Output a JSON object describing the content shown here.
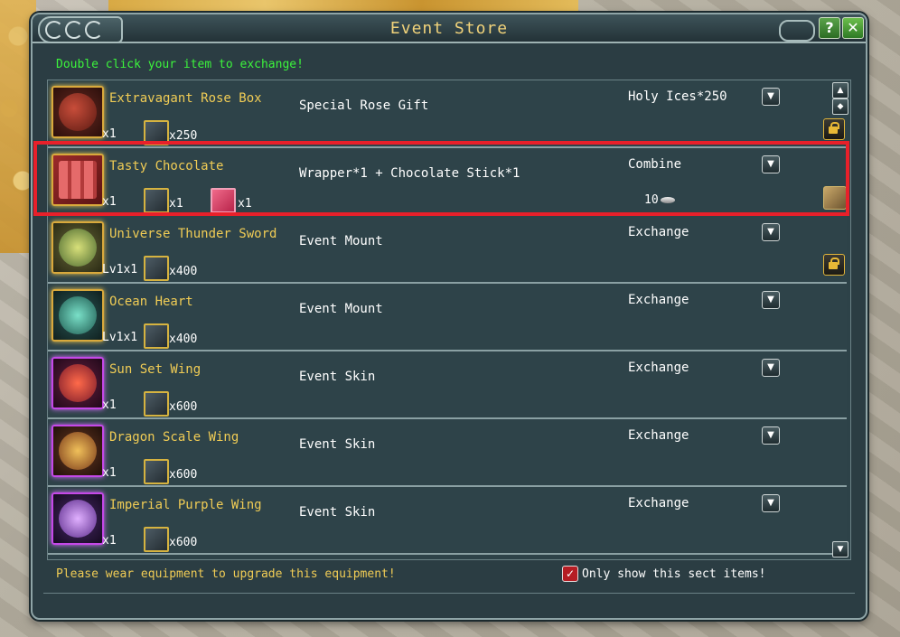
{
  "window": {
    "title": "Event Store",
    "help_label": "?",
    "close_label": "✕"
  },
  "instruction": "Double click your item to exchange!",
  "items": [
    {
      "name": "Extravagant Rose Box",
      "qty": "x1",
      "materials": [
        {
          "count": "x250"
        }
      ],
      "description": "Special Rose Gift",
      "action": "Holy Ices*250",
      "locked": true,
      "icon": "rose-box-icon"
    },
    {
      "name": "Tasty Chocolate",
      "qty": "x1",
      "materials": [
        {
          "count": "x1"
        },
        {
          "count": "x1"
        }
      ],
      "description": "Wrapper*1 + Chocolate Stick*1",
      "action": "Combine",
      "silver": "10",
      "icon": "chocolate-icon"
    },
    {
      "name": "Universe Thunder Sword",
      "qty": "Lv1x1",
      "materials": [
        {
          "count": "x400"
        }
      ],
      "description": "Event Mount",
      "action": "Exchange",
      "locked": true,
      "icon": "thunder-sword-icon"
    },
    {
      "name": "Ocean Heart",
      "qty": "Lv1x1",
      "materials": [
        {
          "count": "x400"
        }
      ],
      "description": "Event Mount",
      "action": "Exchange",
      "icon": "ocean-heart-icon"
    },
    {
      "name": "Sun Set Wing",
      "qty": "x1",
      "materials": [
        {
          "count": "x600"
        }
      ],
      "description": "Event Skin",
      "action": "Exchange",
      "icon": "wing-icon"
    },
    {
      "name": "Dragon Scale Wing",
      "qty": "x1",
      "materials": [
        {
          "count": "x600"
        }
      ],
      "description": "Event Skin",
      "action": "Exchange",
      "icon": "wing-icon"
    },
    {
      "name": "Imperial Purple Wing",
      "qty": "x1",
      "materials": [
        {
          "count": "x600"
        }
      ],
      "description": "Event Skin",
      "action": "Exchange",
      "icon": "wing-icon"
    }
  ],
  "footer": {
    "note": "Please wear equipment to upgrade this equipment!",
    "filter_label": "Only show this sect items!",
    "filter_checked": true
  },
  "colors": {
    "highlight": "#e8202a",
    "name": "#f0cc55",
    "instruction": "#3cf43c"
  }
}
